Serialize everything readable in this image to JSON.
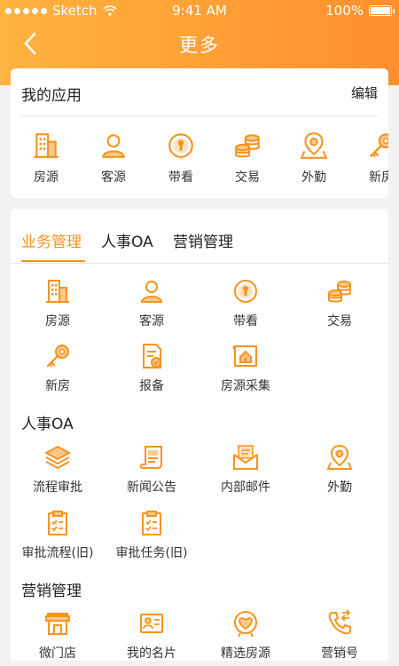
{
  "status_bar": {
    "carrier": "Sketch",
    "time": "9:41 AM",
    "battery": "100%"
  },
  "nav": {
    "title": "更多",
    "back_icon": "chevron-left-icon"
  },
  "my_apps": {
    "title": "我的应用",
    "edit_label": "编辑",
    "items": [
      {
        "label": "房源",
        "icon": "building-icon"
      },
      {
        "label": "客源",
        "icon": "person-icon"
      },
      {
        "label": "带看",
        "icon": "keyhole-icon"
      },
      {
        "label": "交易",
        "icon": "coins-icon"
      },
      {
        "label": "外勤",
        "icon": "map-pin-icon"
      },
      {
        "label": "新房",
        "icon": "key-icon"
      }
    ]
  },
  "tabs": [
    {
      "label": "业务管理",
      "active": true
    },
    {
      "label": "人事OA",
      "active": false
    },
    {
      "label": "营销管理",
      "active": false
    }
  ],
  "sections": {
    "business": {
      "items": [
        {
          "label": "房源",
          "icon": "building-icon"
        },
        {
          "label": "客源",
          "icon": "person-icon"
        },
        {
          "label": "带看",
          "icon": "keyhole-icon"
        },
        {
          "label": "交易",
          "icon": "coins-icon"
        },
        {
          "label": "新房",
          "icon": "key-icon"
        },
        {
          "label": "报备",
          "icon": "document-check-icon"
        },
        {
          "label": "房源采集",
          "icon": "house-map-icon"
        }
      ]
    },
    "hr": {
      "title": "人事OA",
      "items": [
        {
          "label": "流程审批",
          "icon": "layers-icon"
        },
        {
          "label": "新闻公告",
          "icon": "scroll-icon"
        },
        {
          "label": "内部邮件",
          "icon": "mail-icon"
        },
        {
          "label": "外勤",
          "icon": "map-pin-icon"
        },
        {
          "label": "审批流程(旧)",
          "icon": "clipboard-check-icon"
        },
        {
          "label": "审批任务(旧)",
          "icon": "clipboard-check-icon"
        }
      ]
    },
    "marketing": {
      "title": "营销管理",
      "items": [
        {
          "label": "微门店",
          "icon": "storefront-icon"
        },
        {
          "label": "我的名片",
          "icon": "id-card-icon"
        },
        {
          "label": "精选房源",
          "icon": "heart-badge-icon"
        },
        {
          "label": "营销号",
          "icon": "phone-icon"
        }
      ]
    }
  },
  "colors": {
    "accent": "#f7931e",
    "header_start": "#ffb340",
    "header_end": "#ff8f2e"
  }
}
